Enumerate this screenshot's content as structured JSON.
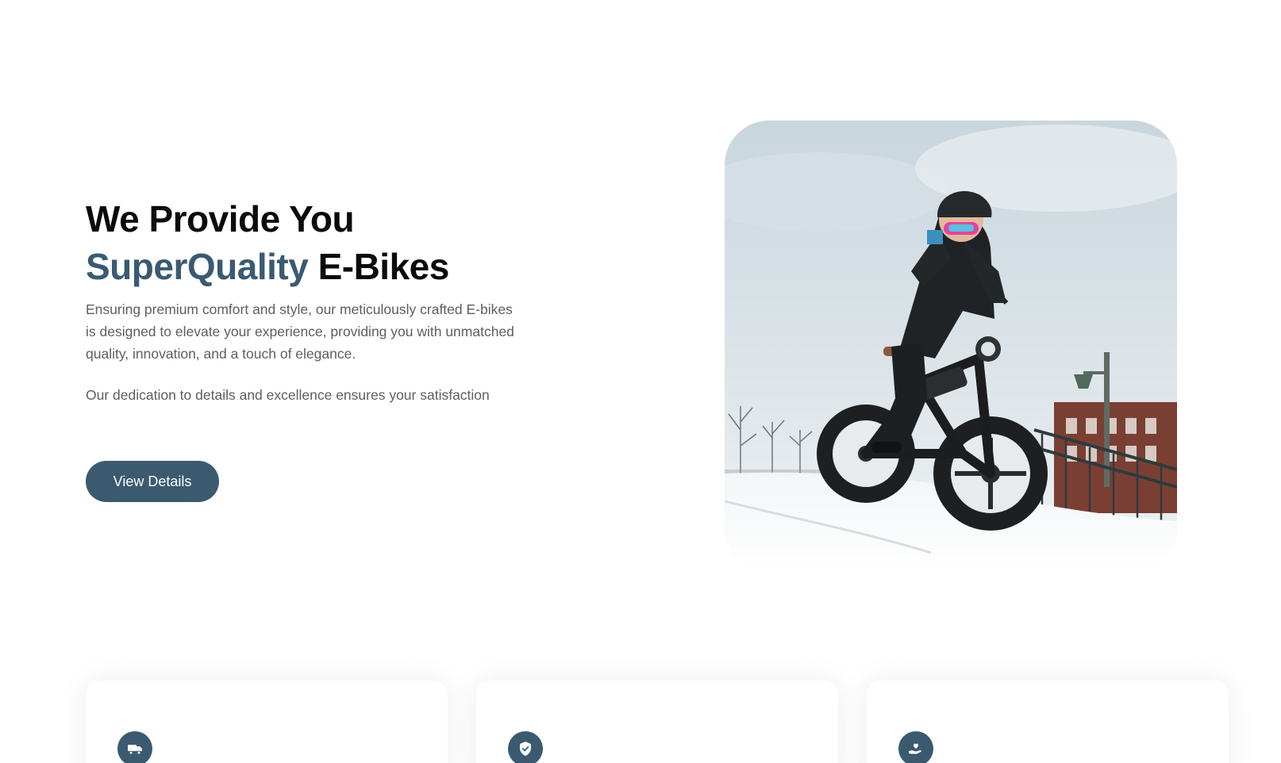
{
  "hero": {
    "title_line1": "We Provide You",
    "title_accent": "SuperQuality",
    "title_rest": "E-Bikes",
    "description": "Ensuring premium comfort and style, our meticulously crafted E-bikes is designed to elevate your experience, providing you with unmatched quality, innovation, and a touch of elegance.",
    "subtext": "Our dedication to details and excellence ensures your satisfaction",
    "cta_label": "View Details",
    "image_alt": "Rider on a fat-tire e-bike in the snow"
  },
  "features": [
    {
      "icon": "delivery-truck-icon"
    },
    {
      "icon": "shield-check-icon"
    },
    {
      "icon": "heart-hand-icon"
    }
  ],
  "colors": {
    "accent": "#3b5a70",
    "heading": "#0b0b0b",
    "body_text": "#5e5e5e",
    "background": "#ffffff"
  }
}
